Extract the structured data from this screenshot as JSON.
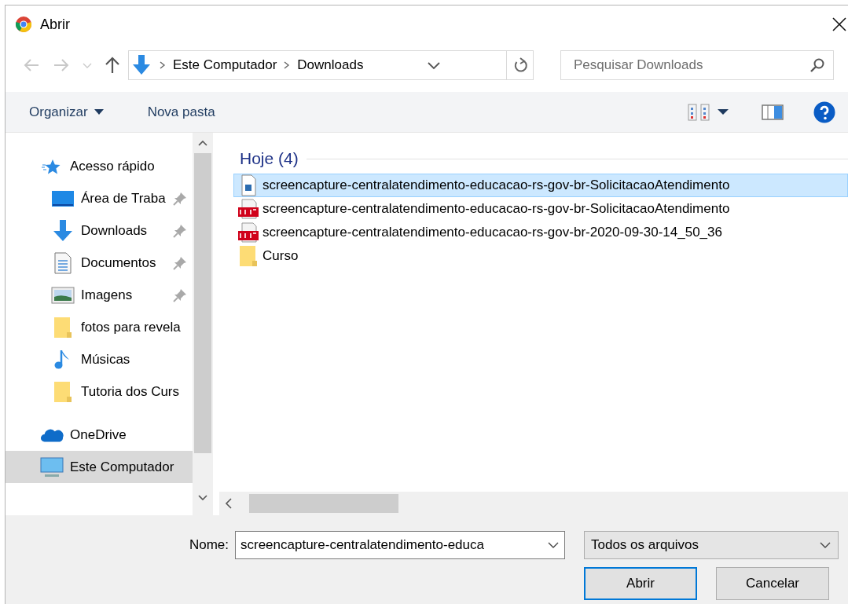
{
  "window": {
    "title": "Abrir"
  },
  "nav": {
    "back_disabled": true,
    "forward_disabled": true
  },
  "address": {
    "segments": [
      "Este Computador",
      "Downloads"
    ]
  },
  "search": {
    "placeholder": "Pesquisar Downloads"
  },
  "toolbar": {
    "organize": "Organizar",
    "new_folder": "Nova pasta"
  },
  "sidebar": {
    "items": [
      {
        "label": "Acesso rápido",
        "kind": "quick",
        "selected": false,
        "children": [
          {
            "label": "Área de Traba",
            "kind": "desktop",
            "pinned": true,
            "selected": false
          },
          {
            "label": "Downloads",
            "kind": "download",
            "pinned": true,
            "selected": false
          },
          {
            "label": "Documentos",
            "kind": "document",
            "pinned": true,
            "selected": false
          },
          {
            "label": "Imagens",
            "kind": "image",
            "pinned": true,
            "selected": false
          },
          {
            "label": "fotos para revela",
            "kind": "folder",
            "pinned": false,
            "selected": false
          },
          {
            "label": "Músicas",
            "kind": "music",
            "pinned": false,
            "selected": false
          },
          {
            "label": "Tutoria dos Curs",
            "kind": "folder",
            "pinned": false,
            "selected": false
          }
        ]
      },
      {
        "label": "OneDrive",
        "kind": "cloud",
        "selected": false
      },
      {
        "label": "Este Computador",
        "kind": "computer",
        "selected": true
      }
    ]
  },
  "files": {
    "group": "Hoje (4)",
    "items": [
      {
        "name": "screencapture-centralatendimento-educacao-rs-gov-br-SolicitacaoAtendimento",
        "kind": "image",
        "selected": true
      },
      {
        "name": "screencapture-centralatendimento-educacao-rs-gov-br-SolicitacaoAtendimento",
        "kind": "pdf",
        "selected": false
      },
      {
        "name": "screencapture-centralatendimento-educacao-rs-gov-br-2020-09-30-14_50_36",
        "kind": "pdf",
        "selected": false
      },
      {
        "name": "Curso",
        "kind": "folder",
        "selected": false
      }
    ]
  },
  "footer": {
    "name_label": "Nome:",
    "name_value": "screencapture-centralatendimento-educa",
    "file_type": "Todos os arquivos",
    "buttons": [
      {
        "label": "Abrir",
        "default": true
      },
      {
        "label": "Cancelar",
        "default": false
      }
    ]
  }
}
